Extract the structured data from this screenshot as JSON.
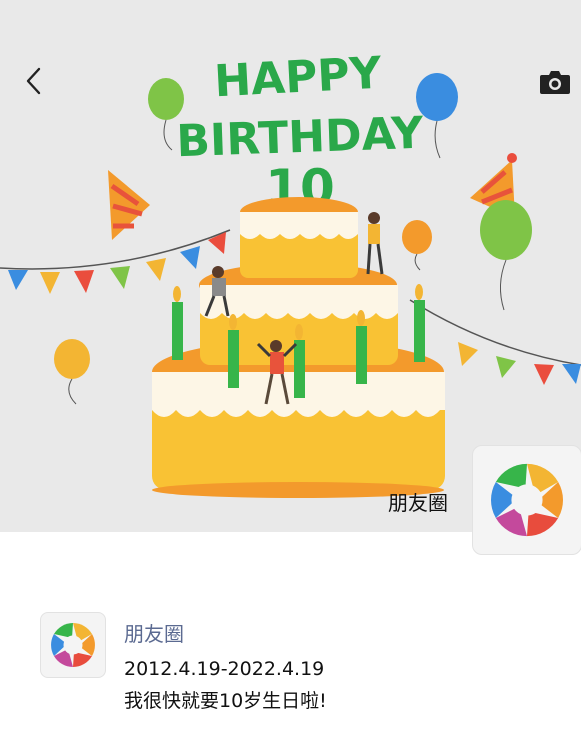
{
  "cover": {
    "headline": [
      "HAPPY",
      "BIRTHDAY"
    ],
    "number": "10",
    "owner_name": "朋友圈",
    "colors": {
      "background": "#e9e9e9",
      "headline_green": "#2aa84a",
      "cake_orange": "#f39a2c",
      "cake_yellow": "#f9c234",
      "cream": "#fdf6e6",
      "candle_green": "#37b54a"
    }
  },
  "icons": {
    "back": "chevron-left-icon",
    "camera": "camera-icon",
    "avatar": "aperture-logo-icon"
  },
  "post": {
    "author": "朋友圈",
    "date_range": "2012.4.19-2022.4.19",
    "text": "我很快就要10岁生日啦!"
  }
}
